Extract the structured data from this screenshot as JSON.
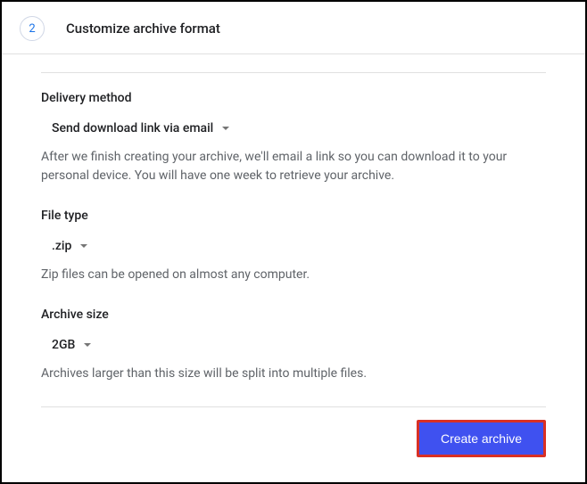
{
  "header": {
    "step_number": "2",
    "title": "Customize archive format"
  },
  "delivery": {
    "label": "Delivery method",
    "selected": "Send download link via email",
    "description": "After we finish creating your archive, we'll email a link so you can download it to your personal device. You will have one week to retrieve your archive."
  },
  "filetype": {
    "label": "File type",
    "selected": ".zip",
    "description": "Zip files can be opened on almost any computer."
  },
  "archivesize": {
    "label": "Archive size",
    "selected": "2GB",
    "description": "Archives larger than this size will be split into multiple files."
  },
  "actions": {
    "create_label": "Create archive"
  }
}
